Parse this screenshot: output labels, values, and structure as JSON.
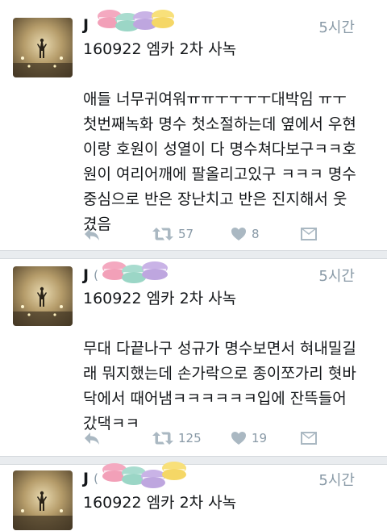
{
  "tweets": [
    {
      "name": "J",
      "handle_partial": "",
      "time": "5시간",
      "lines": [
        "160922 엠카 2차 사녹",
        "",
        "애들 너무귀여워ㅠㅠㅜㅜㅜㅜ대박임 ㅠㅜ",
        "첫번째녹화 명수 첫소절하는데 옆에서 우현",
        "이랑 호원이 성열이 다 명수쳐다보구ㅋㅋ호",
        "원이 여리어깨에 팔올리고있구 ㅋㅋㅋ 명수",
        "중심으로 반은 장난치고 반은 진지해서 웃",
        "겼음"
      ],
      "retweets": "57",
      "likes": "8"
    },
    {
      "name": "J",
      "handle_partial": "(",
      "time": "5시간",
      "lines": [
        "160922 엠카 2차 사녹",
        "",
        "무대 다끝나구 성규가 명수보면서 혀내밀길",
        "래 뭐지했는데 손가락으로 종이쪼가리 혓바",
        "닥에서 때어냄ㅋㅋㅋㅋㅋㅋ입에 잔뜩들어",
        "갔댁ㅋㅋ"
      ],
      "retweets": "125",
      "likes": "19"
    },
    {
      "name": "J",
      "handle_partial": "(",
      "time": "5시간",
      "lines": [
        "160922 엠카 2차 사녹"
      ],
      "retweets": "",
      "likes": ""
    }
  ],
  "icons": {
    "reply": "reply-icon",
    "retweet": "retweet-icon",
    "like": "heart-icon",
    "dm": "envelope-icon"
  },
  "colors": {
    "icon_gray": "#aab8c2",
    "text_gray": "#8899a6",
    "separator": "#e9ecef"
  }
}
